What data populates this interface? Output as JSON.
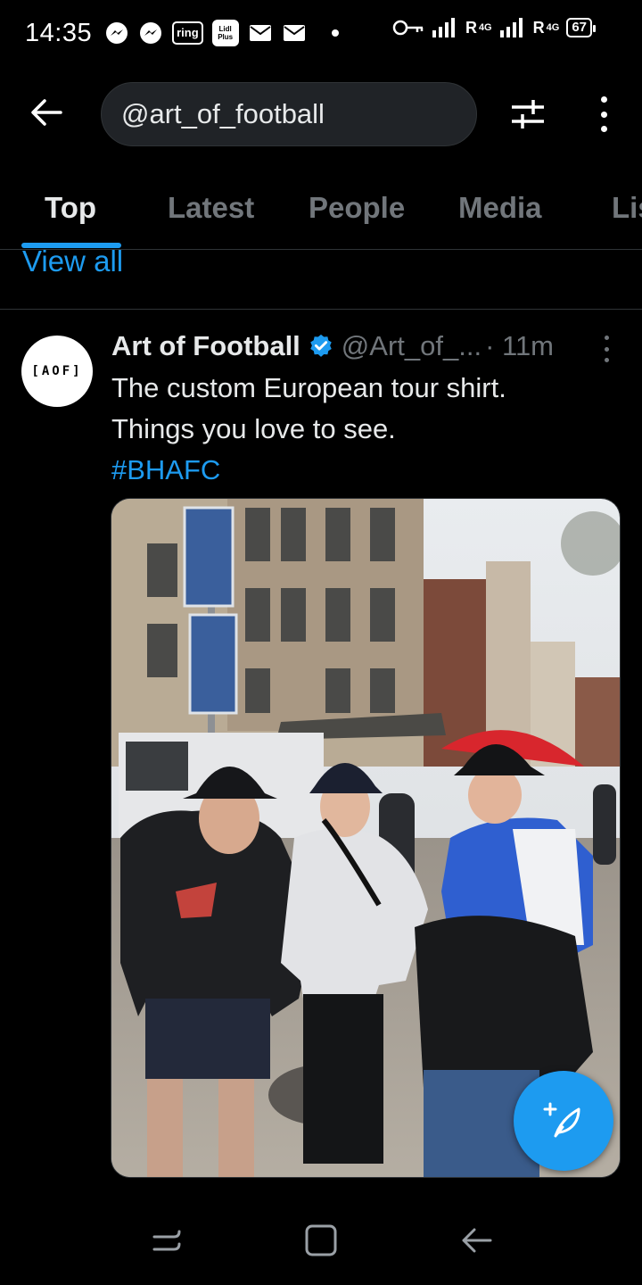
{
  "status_bar": {
    "time": "14:35",
    "notification_icons": [
      "messenger-icon",
      "messenger-icon",
      "ring-icon",
      "lidl-plus-icon",
      "mail-icon",
      "mail-icon"
    ],
    "ring_label": "ring",
    "lidl_label_top": "Lidl",
    "lidl_label_bottom": "Plus",
    "network_1": "R",
    "network_1_type": "4G",
    "network_2": "R",
    "network_2_type": "4G",
    "battery": "67"
  },
  "search": {
    "query": "@art_of_football"
  },
  "tabs": [
    {
      "label": "Top",
      "active": true
    },
    {
      "label": "Latest",
      "active": false
    },
    {
      "label": "People",
      "active": false
    },
    {
      "label": "Media",
      "active": false
    },
    {
      "label": "Lists",
      "active": false
    }
  ],
  "view_all": "View all",
  "tweet": {
    "avatar_text": "[AOF]",
    "author": "Art of Football",
    "handle": "@Art_of_...",
    "time": "· 11m",
    "text_line1": "The custom European tour shirt.",
    "text_line2": "Things you love to see.",
    "hashtag": "#BHAFC"
  },
  "colors": {
    "accent": "#1d9bf0",
    "background": "#000000",
    "muted": "#71767b",
    "text": "#e7e9ea"
  }
}
